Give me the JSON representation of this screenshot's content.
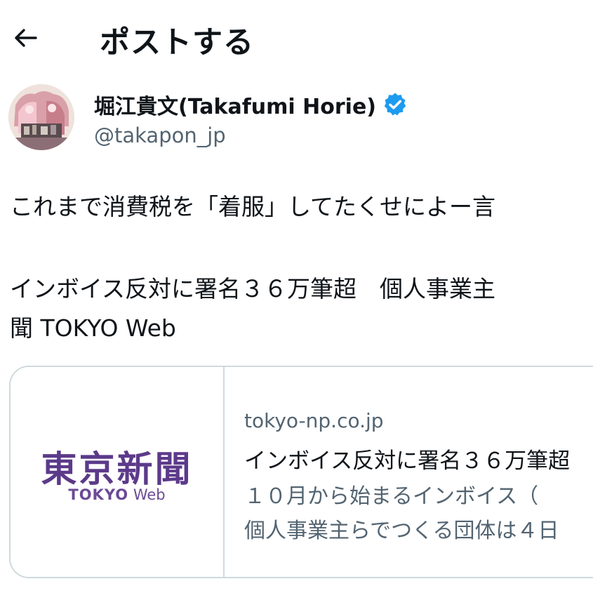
{
  "header": {
    "back_icon": "arrow-left-icon",
    "title": "ポストする"
  },
  "author": {
    "avatar_icon": "avatar-image",
    "name": "堀江貴文(Takafumi Horie)",
    "verified_icon": "verified-badge-icon",
    "verified_color": "#1d9bf0",
    "handle": "@takapon_jp"
  },
  "tweet": {
    "lines": [
      "これまで消費税を「着服」してたくせによー言",
      "インボイス反対に署名３６万筆超　個人事業主",
      "聞 TOKYO Web"
    ]
  },
  "card": {
    "logo_jp": "東京新聞",
    "logo_en_bold": "TOKYO",
    "logo_en_light": "Web",
    "logo_color": "#5c3a8a",
    "domain": "tokyo-np.co.jp",
    "title": "インボイス反対に署名３６万筆超",
    "desc_lines": [
      "１０月から始まるインボイス（",
      "個人事業主らでつくる団体は４日"
    ]
  },
  "colors": {
    "text": "#0f1419",
    "secondary": "#536471",
    "border": "#cfd9de"
  }
}
